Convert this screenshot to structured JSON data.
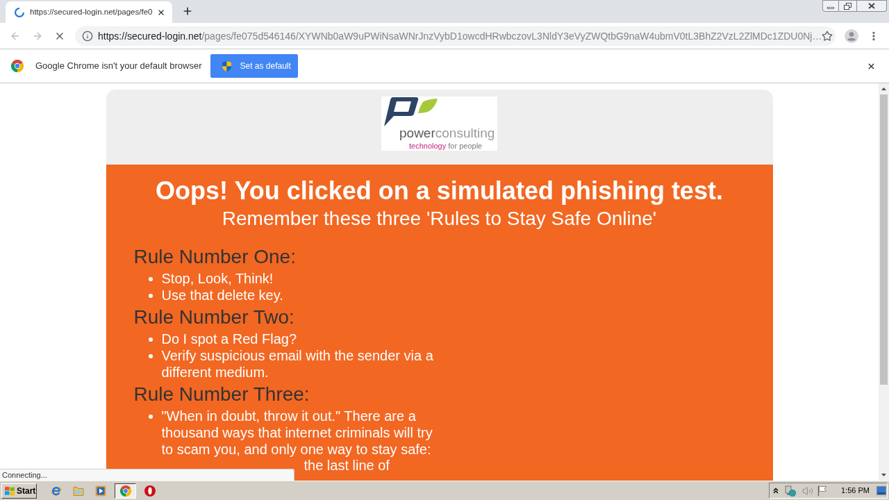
{
  "browser": {
    "loading": true,
    "tab": {
      "title": "https://secured-login.net/pages/fe0"
    },
    "nav_buttons": [
      {
        "kind": "back",
        "disabled": true
      },
      {
        "kind": "forward",
        "disabled": true
      }
    ],
    "address_bar": {
      "host": "https://secured-login.net",
      "path": "/pages/fe075d546146/XYWNb0aW9uPWiNsaWNrJnzVybD1owcdHRwbczovL3NldY3eVyZWQtbG9naW4ubmV0tL3BhZ2VzL2ZlMDc1ZDU0Nj…"
    },
    "infobar": {
      "message": "Google Chrome isn't your default browser",
      "button": "Set as default"
    }
  },
  "page": {
    "logo": {
      "name_dark": "power",
      "name_light": "consulting",
      "tagline_accent": "technology",
      "tagline": "for people"
    },
    "title": "Oops! You clicked on a simulated phishing test.",
    "subtitle": "Remember these three 'Rules to Stay Safe Online'",
    "rules": [
      {
        "heading": "Rule Number One:",
        "points": [
          "Stop, Look, Think!",
          "Use that delete key."
        ]
      },
      {
        "heading": "Rule Number Two:",
        "points": [
          "Do I spot a Red Flag?",
          "Verify suspicious email with the sender via a different medium."
        ]
      },
      {
        "heading": "Rule Number Three:",
        "points": [
          "\"When in doubt, throw it out.\" There are a thousand ways that internet criminals will try to scam you, and only one way to stay safe:"
        ],
        "cut_line": "the last line of"
      }
    ]
  },
  "status_bubble": "Connecting...",
  "taskbar": {
    "start": "Start",
    "apps": [
      {
        "kind": "e_logo",
        "selected": false
      },
      {
        "kind": "folder",
        "selected": false
      },
      {
        "kind": "player",
        "selected": false
      },
      {
        "kind": "wheel",
        "selected": true
      },
      {
        "kind": "ring",
        "selected": false
      }
    ],
    "clock": "1:56 PM"
  }
}
